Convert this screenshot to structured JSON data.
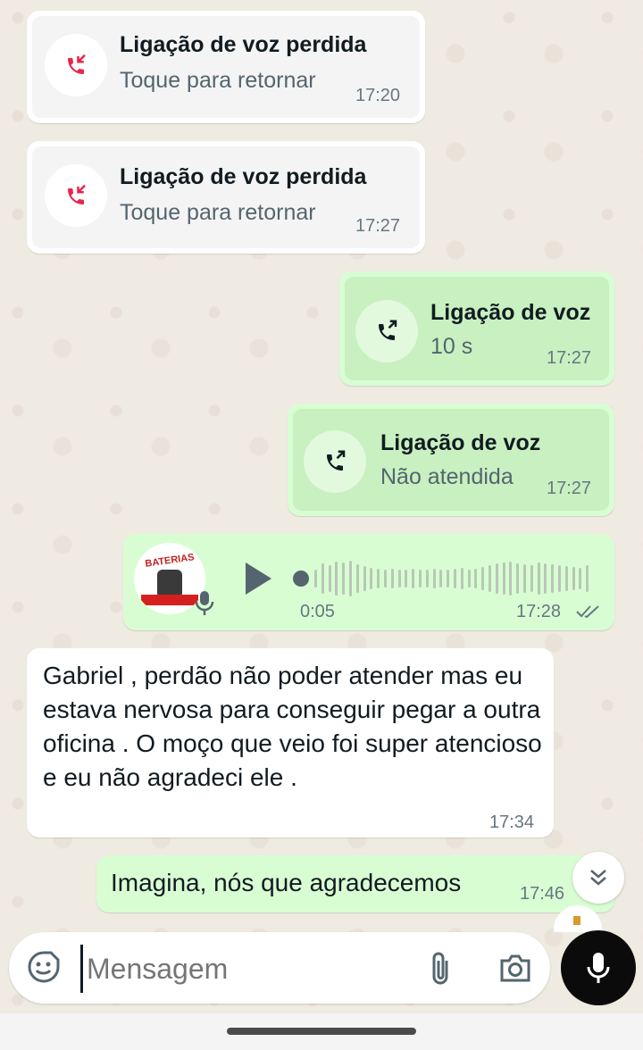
{
  "messages": {
    "missed1": {
      "title": "Ligação de voz perdida",
      "subtitle": "Toque para retornar",
      "time": "17:20"
    },
    "missed2": {
      "title": "Ligação de voz perdida",
      "subtitle": "Toque para retornar",
      "time": "17:27"
    },
    "outcall1": {
      "title": "Ligação de voz",
      "subtitle": "10 s",
      "time": "17:27"
    },
    "outcall2": {
      "title": "Ligação de voz",
      "subtitle": "Não atendida",
      "time": "17:27"
    },
    "voice": {
      "duration": "0:05",
      "time": "17:28",
      "status_icon": "double-check-icon",
      "avatar_brand": "BATERIAS"
    },
    "text1": {
      "text": "Gabriel , perdão não poder atender mas eu estava nervosa para conseguir pegar a outra oficina . O moço que veio foi super atencioso e eu não agradeci ele .",
      "time": "17:34"
    },
    "text2": {
      "text": "Imagina, nós que agradecemos",
      "time": "17:46"
    }
  },
  "composer": {
    "placeholder": "Mensagem"
  },
  "colors": {
    "incoming": "#ffffff",
    "outgoing": "#d9fdd3",
    "missed_red": "#e8264a",
    "background": "#efeae2"
  }
}
